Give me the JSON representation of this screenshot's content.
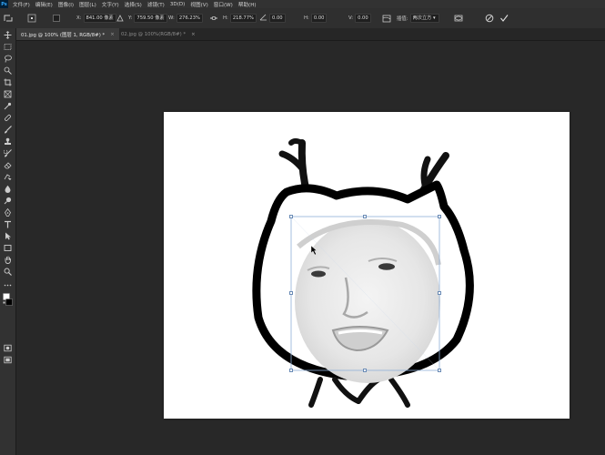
{
  "menu": {
    "logo": "Ps",
    "items": [
      "文件(F)",
      "编辑(E)",
      "图像(I)",
      "图层(L)",
      "文字(Y)",
      "选择(S)",
      "滤镜(T)",
      "3D(D)",
      "视图(V)",
      "窗口(W)",
      "帮助(H)"
    ]
  },
  "options": {
    "x_label": "X:",
    "x_value": "841.00 像素",
    "y_label": "Y:",
    "y_value": "759.50 像素",
    "w_label": "W:",
    "w_value": "276.23%",
    "h_label": "H:",
    "h_value": "218.77%",
    "angle_value": "0.00",
    "hskew_label": "H:",
    "hskew_value": "0.00",
    "vskew_label": "V:",
    "vskew_value": "0.00",
    "interp_label": "插值:",
    "interp_value": "两次立方"
  },
  "tabs": [
    {
      "label": "01.jpg @ 100% (图层 1, RGB/8#) *",
      "close": "×"
    },
    {
      "label": "02.jpg @ 100%(RGB/8#) *",
      "close": "×"
    }
  ],
  "colors": {
    "accent": "#31a8ff",
    "canvas": "#ffffff",
    "workspace": "#282828",
    "handle_line": "#6a8bb5"
  },
  "icons": [
    "move-icon",
    "marquee-icon",
    "lasso-icon",
    "quick-select-icon",
    "crop-icon",
    "frame-icon",
    "eyedropper-icon",
    "healing-icon",
    "brush-icon",
    "stamp-icon",
    "history-brush-icon",
    "eraser-icon",
    "gradient-icon",
    "blur-icon",
    "dodge-icon",
    "pen-icon",
    "type-icon",
    "path-select-icon",
    "rectangle-icon",
    "hand-icon",
    "zoom-icon",
    "more-tools-icon",
    "color-swatches",
    "quick-mask-icon",
    "screen-mode-icon"
  ]
}
